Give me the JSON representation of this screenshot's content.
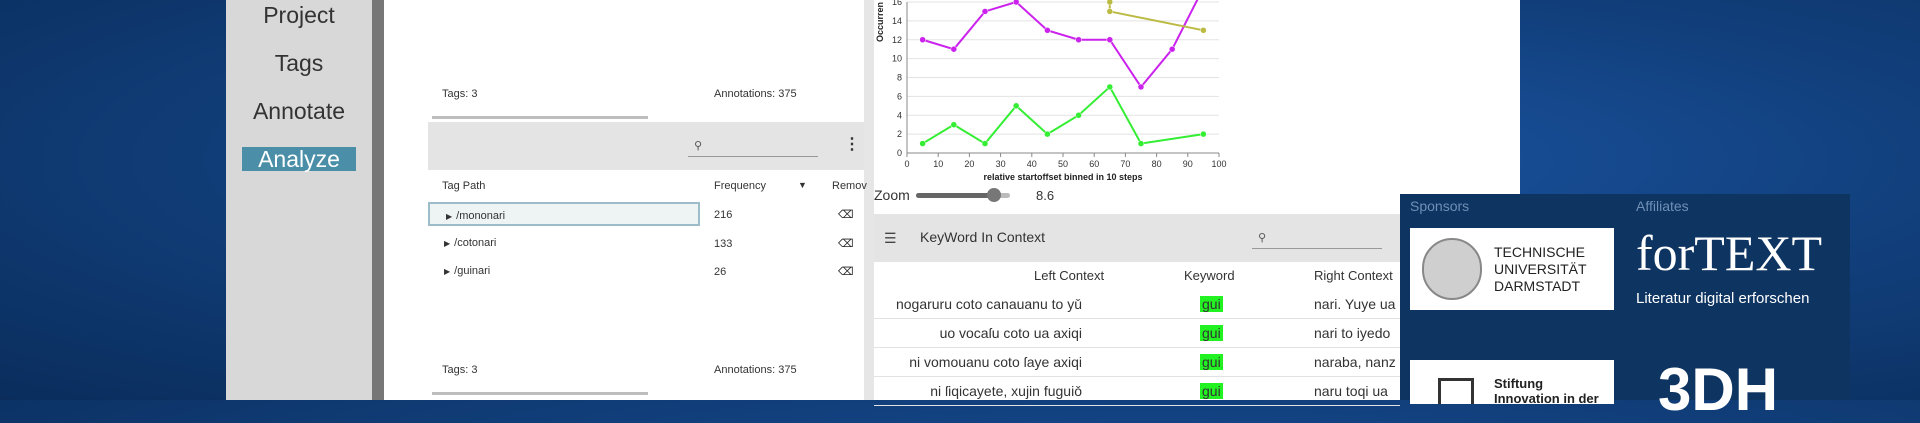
{
  "nav": {
    "items": [
      {
        "label": "Project"
      },
      {
        "label": "Tags"
      },
      {
        "label": "Annotate"
      },
      {
        "label": "Analyze"
      }
    ]
  },
  "top_panel": {
    "tags": "Tags: 3",
    "annotations": "Annotations: 375"
  },
  "tag_table": {
    "search_placeholder": "",
    "headers": {
      "path": "Tag Path",
      "frequency": "Frequency",
      "remove": "Remov"
    },
    "rows": [
      {
        "path": "/mononari",
        "frequency": "216"
      },
      {
        "path": "/cotonari",
        "frequency": "133"
      },
      {
        "path": "/guinari",
        "frequency": "26"
      }
    ],
    "footer_tags": "Tags: 3",
    "footer_annotations": "Annotations: 375"
  },
  "chart_data": {
    "type": "line",
    "xlabel": "relative startoffset binned in 10 steps",
    "ylabel": "Occurren",
    "xlim": [
      0,
      100
    ],
    "ylim": [
      0,
      16
    ],
    "x_ticks": [
      0,
      10,
      20,
      30,
      40,
      50,
      60,
      70,
      80,
      90,
      100
    ],
    "y_ticks": [
      0,
      2,
      4,
      6,
      8,
      10,
      12,
      14,
      16
    ],
    "series": [
      {
        "color": "#cc22ee",
        "x": [
          5,
          15,
          25,
          35,
          45,
          55,
          65,
          75,
          85,
          95
        ],
        "y": [
          12,
          11,
          15,
          16,
          13,
          12,
          12,
          7,
          11,
          17.5
        ]
      },
      {
        "color": "#33ee33",
        "x": [
          5,
          15,
          25,
          35,
          45,
          55,
          65,
          75,
          95
        ],
        "y": [
          1,
          3,
          1,
          5,
          2,
          4,
          7,
          1,
          2
        ]
      },
      {
        "color": "#bbbb44",
        "x": [
          65,
          65,
          95
        ],
        "y": [
          16,
          15,
          13
        ]
      }
    ]
  },
  "zoom": {
    "label": "Zoom",
    "value": "8.6",
    "level": 0.83
  },
  "kwic": {
    "title": "KeyWord In Context",
    "headers": {
      "left": "Left Context",
      "keyword": "Keyword",
      "right": "Right Context"
    },
    "rows": [
      {
        "left": "nogaruru coto canauanu to yǔ",
        "keyword": "gui",
        "right": "nari. Yuye ua"
      },
      {
        "left": "uo vocaſu coto ua axiqi",
        "keyword": "gui",
        "right": "nari to iyedo"
      },
      {
        "left": "ni vomouanu coto ſaye axiqi",
        "keyword": "gui",
        "right": "naraba, nanz"
      },
      {
        "left": "ni ſiqicayete, xujin fuguiǒ",
        "keyword": "gui",
        "right": "naru toqi ua"
      }
    ]
  },
  "sponsors": {
    "sponsors_label": "Sponsors",
    "affiliates_label": "Affiliates",
    "tud_text": [
      "TECHNISCHE",
      "UNIVERSITÄT",
      "DARMSTADT"
    ],
    "fortext_title": "forTEXT",
    "fortext_sub": "Literatur digital erforschen",
    "stiftung_text": [
      "Stiftung",
      "Innovation in der"
    ],
    "dh_text": "3DH"
  }
}
